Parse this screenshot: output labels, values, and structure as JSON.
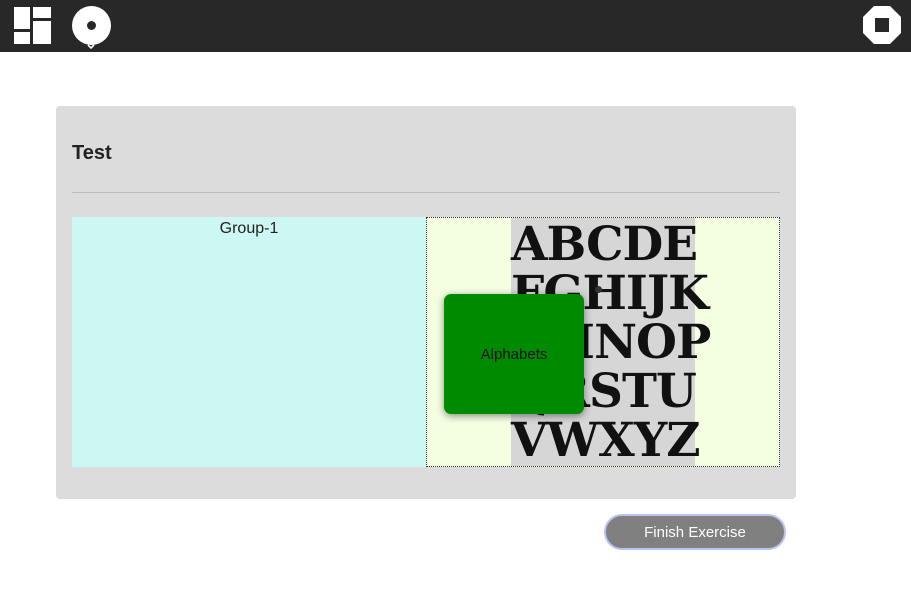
{
  "toolbar": {
    "icons": [
      "dashboard-icon",
      "activity-icon",
      "stop-icon"
    ]
  },
  "exercise": {
    "title": "Test",
    "group": {
      "label": "Group-1",
      "background": "#ccf7f2"
    },
    "source": {
      "background": "#f4ffe2",
      "image": {
        "alt_lines": [
          "ABCDE",
          "FGHIJK",
          "LMNOP",
          "QRSTU",
          "VWXYZ"
        ]
      },
      "card": {
        "label": "Alphabets",
        "color": "#008a00"
      }
    },
    "finish_button": {
      "label": "Finish Exercise",
      "color": "#808080"
    }
  },
  "colors": {
    "topbar": "#282828",
    "panel": "#dcdcdc"
  }
}
